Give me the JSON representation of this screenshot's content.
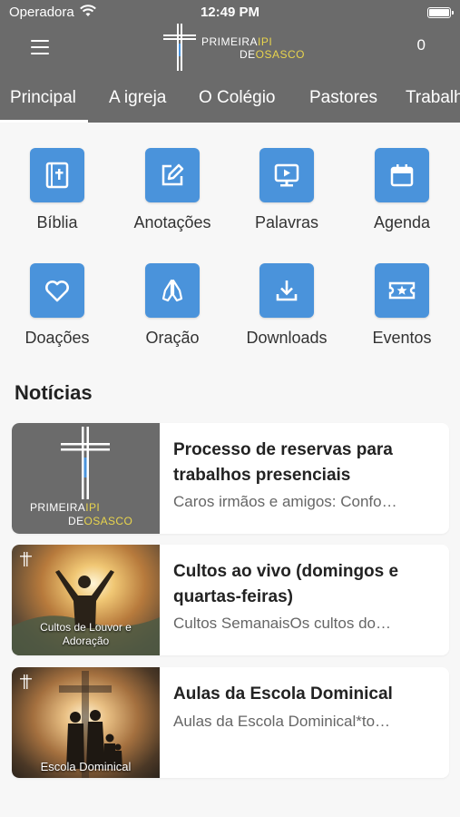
{
  "status_bar": {
    "carrier": "Operadora",
    "time": "12:49 PM"
  },
  "header": {
    "logo": {
      "line1_a": "PRIMEIRA",
      "line1_b": "IPI",
      "line2_a": "DE",
      "line2_b": "OSASCO"
    },
    "cart_count": "0"
  },
  "tabs": [
    {
      "label": "Principal",
      "active": true
    },
    {
      "label": "A igreja"
    },
    {
      "label": "O Colégio"
    },
    {
      "label": "Pastores"
    },
    {
      "label": "Trabalhos"
    }
  ],
  "shortcuts": [
    {
      "label": "Bíblia",
      "icon": "bible-icon"
    },
    {
      "label": "Anotações",
      "icon": "edit-note-icon"
    },
    {
      "label": "Palavras",
      "icon": "video-monitor-icon"
    },
    {
      "label": "Agenda",
      "icon": "calendar-icon"
    },
    {
      "label": "Doações",
      "icon": "heart-icon"
    },
    {
      "label": "Oração",
      "icon": "praying-hands-icon"
    },
    {
      "label": "Downloads",
      "icon": "download-icon"
    },
    {
      "label": "Eventos",
      "icon": "ticket-star-icon"
    }
  ],
  "news_section": {
    "title": "Notícias",
    "items": [
      {
        "title": "Processo de reservas para trabalhos presenciais",
        "excerpt": "Caros irmãos e amigos: Confo…",
        "thumb_logo": {
          "line1_a": "PRIMEIRA",
          "line1_b": "IPI",
          "line2_a": "DE",
          "line2_b": "OSASCO"
        }
      },
      {
        "title": "Cultos ao vivo (domingos e quartas-feiras)",
        "excerpt": "Cultos SemanaisOs cultos do…",
        "thumb_caption": "Cultos de Louvor e Adoração"
      },
      {
        "title": "Aulas da Escola Dominical",
        "excerpt": "Aulas da Escola Dominical*to…",
        "thumb_caption": "Escola Dominical"
      }
    ]
  },
  "colors": {
    "header_bg": "#6b6b6b",
    "icon_tile": "#4a93db",
    "logo_accent": "#e8d44d",
    "logo_bar": "#4a93db"
  }
}
